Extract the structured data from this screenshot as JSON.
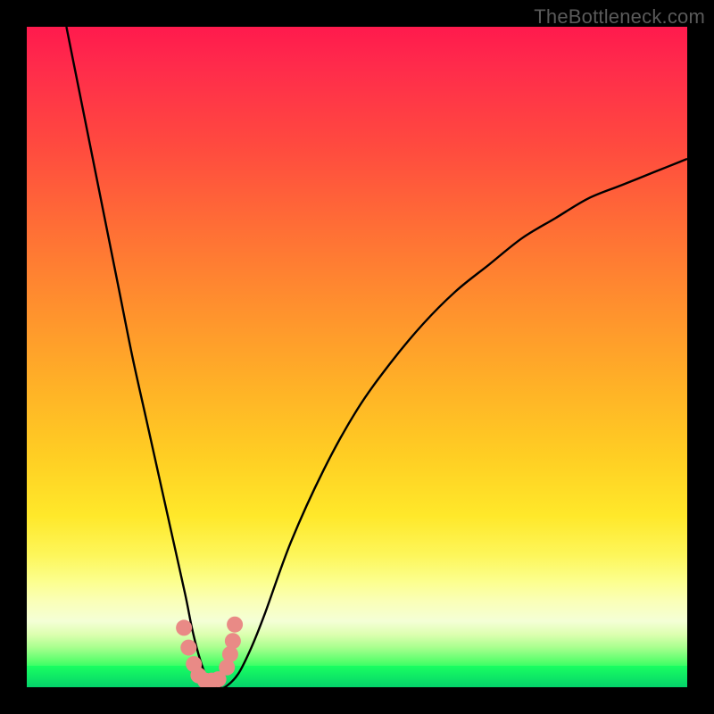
{
  "watermark": "TheBottleneck.com",
  "chart_data": {
    "type": "line",
    "title": "",
    "xlabel": "",
    "ylabel": "",
    "xlim": [
      0,
      100
    ],
    "ylim": [
      0,
      100
    ],
    "grid": false,
    "background": {
      "type": "vertical-gradient",
      "meaning": "bottleneck severity (red=high, green=none)",
      "stops": [
        {
          "pct": 0,
          "color": "#ff1a4d"
        },
        {
          "pct": 50,
          "color": "#ffb027"
        },
        {
          "pct": 80,
          "color": "#fdf65a"
        },
        {
          "pct": 97,
          "color": "#1aff61"
        },
        {
          "pct": 100,
          "color": "#04d26a"
        }
      ]
    },
    "series": [
      {
        "name": "bottleneck-curve",
        "color": "#000000",
        "x": [
          6,
          8,
          10,
          12,
          14,
          16,
          18,
          20,
          22,
          24,
          25,
          26,
          27,
          28,
          29,
          30,
          32,
          34,
          36,
          40,
          45,
          50,
          55,
          60,
          65,
          70,
          75,
          80,
          85,
          90,
          95,
          100
        ],
        "y": [
          100,
          90,
          80,
          70,
          60,
          50,
          41,
          32,
          23,
          14,
          9,
          5,
          2,
          0,
          0,
          0,
          2,
          6,
          11,
          22,
          33,
          42,
          49,
          55,
          60,
          64,
          68,
          71,
          74,
          76,
          78,
          80
        ]
      },
      {
        "name": "fit-markers",
        "color": "#e98a86",
        "marker": "circle",
        "x": [
          23.8,
          24.5,
          25.3,
          26.0,
          27.0,
          28.0,
          29.0,
          30.3,
          30.8,
          31.2,
          31.5
        ],
        "y": [
          9.0,
          6.0,
          3.5,
          1.8,
          1.0,
          1.0,
          1.2,
          3.0,
          5.0,
          7.0,
          9.5
        ]
      }
    ],
    "annotations": []
  },
  "colors": {
    "frame": "#000000",
    "watermark": "#5a5a5a",
    "curve": "#000000",
    "marker": "#e98a86"
  }
}
